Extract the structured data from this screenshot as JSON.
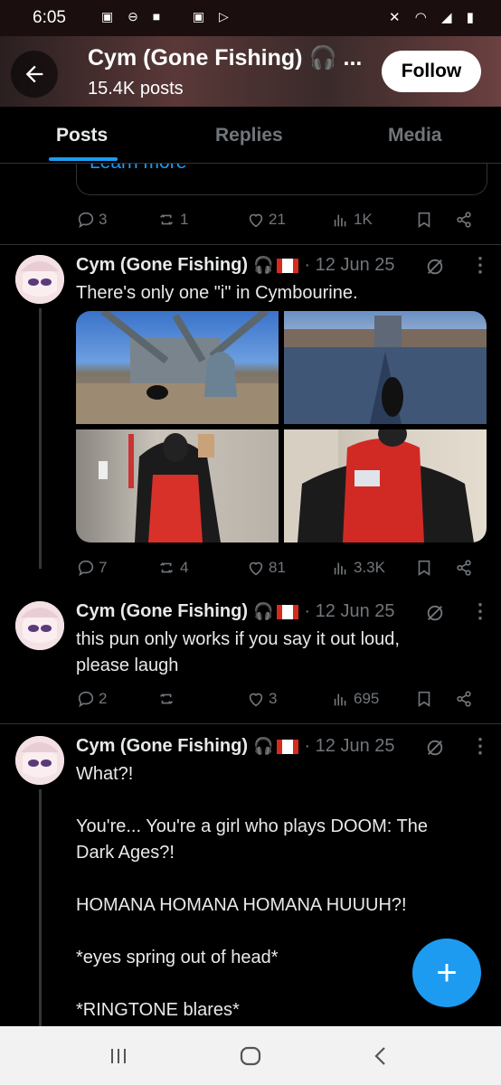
{
  "status_bar": {
    "time": "6:05"
  },
  "header": {
    "name": "Cym (Gone Fishing) 🎧 ...",
    "post_count": "15.4K posts",
    "follow_label": "Follow"
  },
  "tabs": [
    {
      "label": "Posts"
    },
    {
      "label": "Replies"
    },
    {
      "label": "Media"
    }
  ],
  "prev_post": {
    "learn_more": "Learn more",
    "stats": {
      "replies": "3",
      "reposts": "1",
      "likes": "21",
      "views": "1K"
    }
  },
  "posts": [
    {
      "author": "Cym (Gone Fishing)",
      "emoji": "🎧",
      "date": "· 12 Jun 25",
      "text": "There's only one \"i\" in Cymbourine.",
      "stats": {
        "replies": "7",
        "reposts": "4",
        "likes": "81",
        "views": "3.3K"
      }
    },
    {
      "author": "Cym (Gone Fishing)",
      "emoji": "🎧",
      "date": "· 12 Jun 25",
      "text_lines": [
        "this pun only works if you say it out loud,",
        "please laugh"
      ],
      "stats": {
        "replies": "2",
        "reposts": "",
        "likes": "3",
        "views": "695"
      }
    },
    {
      "author": "Cym (Gone Fishing)",
      "emoji": "🎧",
      "date": "· 12 Jun 25",
      "text_lines": [
        "What?!",
        "",
        "You're... You're a girl who plays DOOM: The",
        "Dark Ages?!",
        "",
        "HOMANA HOMANA HOMANA HUUUH?!",
        "",
        "*eyes spring out of head*",
        "",
        "*RINGTONE blares*"
      ]
    }
  ],
  "fab_label": "+",
  "colors": {
    "accent": "#1d9bf0",
    "background": "#000000",
    "muted": "#71767b"
  }
}
